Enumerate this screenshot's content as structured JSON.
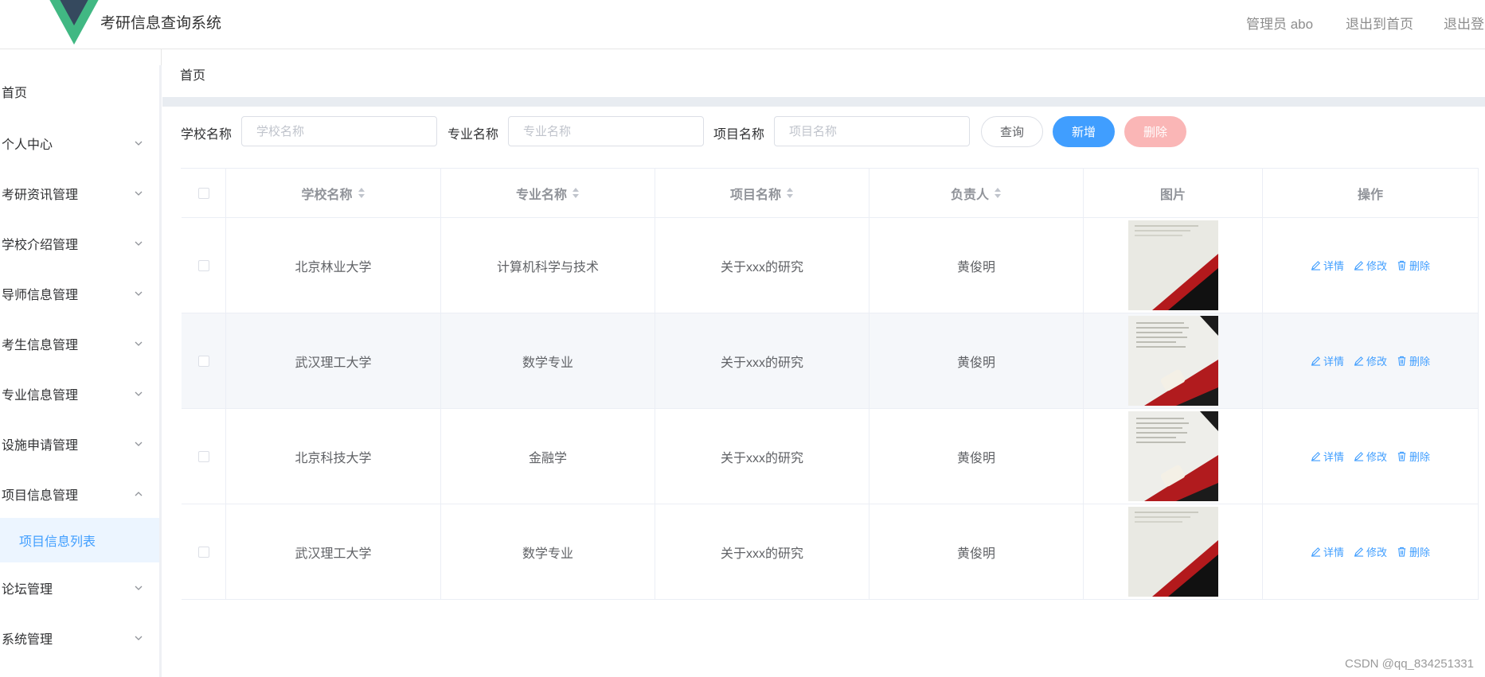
{
  "header": {
    "app_title": "考研信息查询系统",
    "admin_label": "管理员 abo",
    "back_home": "退出到首页",
    "logout": "退出登录"
  },
  "sidebar": {
    "items": [
      {
        "label": "首页",
        "expandable": false
      },
      {
        "label": "个人中心",
        "expandable": true
      },
      {
        "label": "考研资讯管理",
        "expandable": true
      },
      {
        "label": "学校介绍管理",
        "expandable": true
      },
      {
        "label": "导师信息管理",
        "expandable": true
      },
      {
        "label": "考生信息管理",
        "expandable": true
      },
      {
        "label": "专业信息管理",
        "expandable": true
      },
      {
        "label": "设施申请管理",
        "expandable": true
      },
      {
        "label": "项目信息管理",
        "expandable": true,
        "expanded": true
      },
      {
        "label": "论坛管理",
        "expandable": true
      },
      {
        "label": "系统管理",
        "expandable": true
      }
    ],
    "active_sub": "项目信息列表"
  },
  "breadcrumb": "首页",
  "search": {
    "school_label": "学校名称",
    "school_placeholder": "学校名称",
    "major_label": "专业名称",
    "major_placeholder": "专业名称",
    "project_label": "项目名称",
    "project_placeholder": "项目名称",
    "query_btn": "查询",
    "add_btn": "新增",
    "delete_btn": "删除"
  },
  "table": {
    "columns": [
      "学校名称",
      "专业名称",
      "项目名称",
      "负责人",
      "图片",
      "操作"
    ],
    "rows": [
      {
        "school": "北京林业大学",
        "major": "计算机科学与技术",
        "project": "关于xxx的研究",
        "leader": "黄俊明",
        "image": "doc-white"
      },
      {
        "school": "武汉理工大学",
        "major": "数学专业",
        "project": "关于xxx的研究",
        "leader": "黄俊明",
        "image": "doc-dark"
      },
      {
        "school": "北京科技大学",
        "major": "金融学",
        "project": "关于xxx的研究",
        "leader": "黄俊明",
        "image": "doc-dark"
      },
      {
        "school": "武汉理工大学",
        "major": "数学专业",
        "project": "关于xxx的研究",
        "leader": "黄俊明",
        "image": "doc-white"
      }
    ],
    "actions": {
      "detail": "详情",
      "edit": "修改",
      "delete": "删除"
    }
  },
  "watermark": "CSDN @qq_834251331",
  "colors": {
    "primary": "#409eff",
    "danger_light": "#fab6b6",
    "logo_green": "#41b883",
    "logo_dark": "#35495e"
  }
}
